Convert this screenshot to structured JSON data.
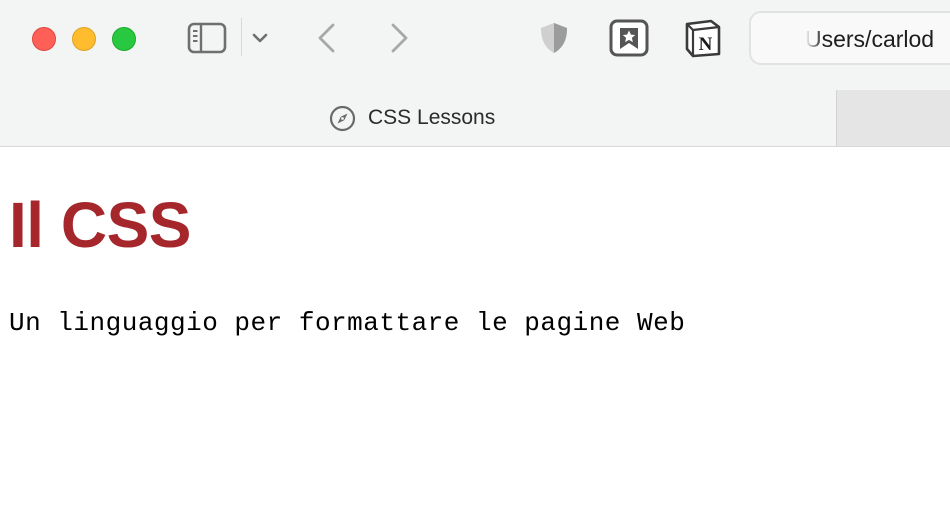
{
  "window": {
    "traffic_lights": {
      "close_color": "#fe5f57",
      "minimize_color": "#febc2e",
      "zoom_color": "#28c840"
    }
  },
  "toolbar": {
    "icons": [
      "sidebar-icon",
      "chevron-down-icon",
      "back-icon",
      "forward-icon",
      "shield-icon",
      "bookmark-star-icon",
      "notion-icon"
    ],
    "address": {
      "text": "Users/carlod"
    }
  },
  "tabs": [
    {
      "title": "CSS Lessons",
      "icon": "compass-icon",
      "active": true
    }
  ],
  "page": {
    "heading": "Il CSS",
    "heading_color": "#a5272c",
    "paragraph": "Un linguaggio per formattare le pagine Web"
  }
}
